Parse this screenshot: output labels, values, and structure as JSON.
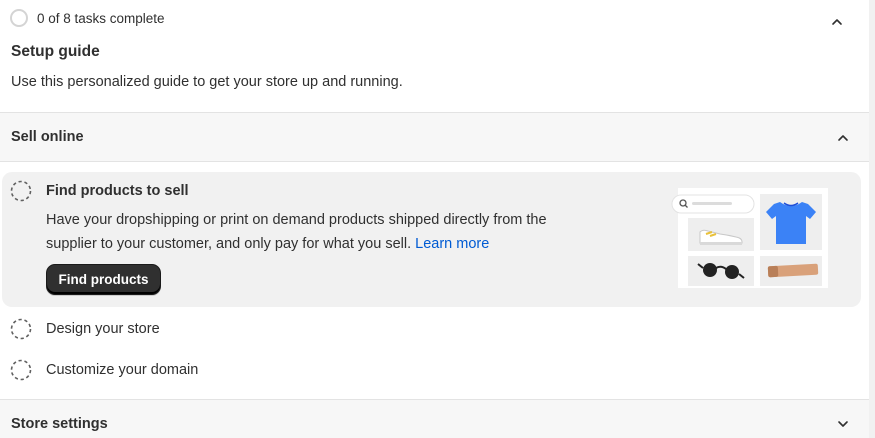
{
  "header": {
    "progress_text": "0 of 8 tasks complete",
    "title": "Setup guide",
    "description": "Use this personalized guide to get your store up and running."
  },
  "sections": {
    "sell_online": {
      "title": "Sell online",
      "state": "expanded",
      "active_task": {
        "title": "Find products to sell",
        "body": "Have your dropshipping or print on demand products shipped directly from the supplier to your customer, and only pay for what you sell.",
        "link_label": "Learn more",
        "button_label": "Find products"
      },
      "tasks": [
        {
          "label": "Design your store"
        },
        {
          "label": "Customize your domain"
        }
      ]
    },
    "store_settings": {
      "title": "Store settings",
      "state": "collapsed"
    }
  },
  "icons": {
    "progress": "progress-circle-icon",
    "collapse": "chevron-up-icon",
    "expand": "chevron-down-icon",
    "task_incomplete": "dashed-circle-icon",
    "illustration": "products-illustration"
  },
  "colors": {
    "primary_button": "#303030",
    "link": "#005bd3",
    "illustration_tshirt": "#3b82f6"
  }
}
